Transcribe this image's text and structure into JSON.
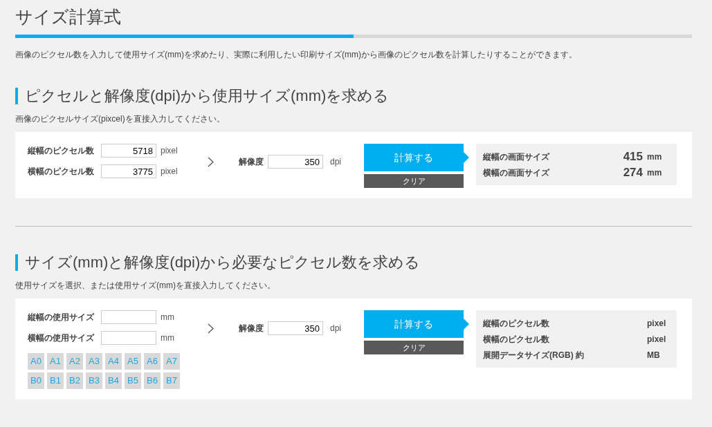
{
  "page": {
    "title": "サイズ計算式",
    "progress": {
      "level": 0.5
    },
    "description": "画像のピクセル数を入力して使用サイズ(mm)を求めたり、実際に利用したい印刷サイズ(mm)から画像のピクセル数を計算したりすることができます。"
  },
  "sections": [
    {
      "heading": "ピクセルと解像度(dpi)から使用サイズ(mm)を求める",
      "note": "画像のピクセルサイズ(pixcel)を直接入力してください。",
      "fields": [
        {
          "label": "縦幅のピクセル数",
          "value": "5718",
          "unit": "pixel"
        },
        {
          "label": "横幅のピクセル数",
          "value": "3775",
          "unit": "pixel"
        }
      ],
      "resolution": {
        "label": "解像度",
        "value": "350",
        "unit": "dpi"
      },
      "calculate_button": "計算する",
      "clear_button": "クリア",
      "results": [
        {
          "label": "縦幅の画面サイズ",
          "value": "415",
          "unit": "mm"
        },
        {
          "label": "横幅の画面サイズ",
          "value": "274",
          "unit": "mm"
        }
      ]
    },
    {
      "heading": "サイズ(mm)と解像度(dpi)から必要なピクセル数を求める",
      "note": "使用サイズを選択、または使用サイズ(mm)を直接入力してください。",
      "fields": [
        {
          "label": "縦幅の使用サイズ",
          "unit": "mm"
        },
        {
          "label": "横幅の使用サイズ",
          "unit": "mm"
        }
      ],
      "size_buttons": [
        [
          "A0",
          "A1",
          "A2",
          "A3",
          "A4",
          "A5",
          "A6",
          "A7"
        ],
        [
          "B0",
          "B1",
          "B2",
          "B3",
          "B4",
          "B5",
          "B6",
          "B7"
        ]
      ],
      "resolution": {
        "label": "解像度",
        "value": "350",
        "unit": "dpi"
      },
      "calculate_button": "計算する",
      "clear_button": "クリア",
      "results": [
        {
          "label": "縦幅のピクセル数",
          "unit": "pixel"
        },
        {
          "label": "横幅のピクセル数",
          "unit": "pixel"
        },
        {
          "label": "展開データサイズ(RGB) 約",
          "unit": "MB"
        }
      ]
    }
  ]
}
